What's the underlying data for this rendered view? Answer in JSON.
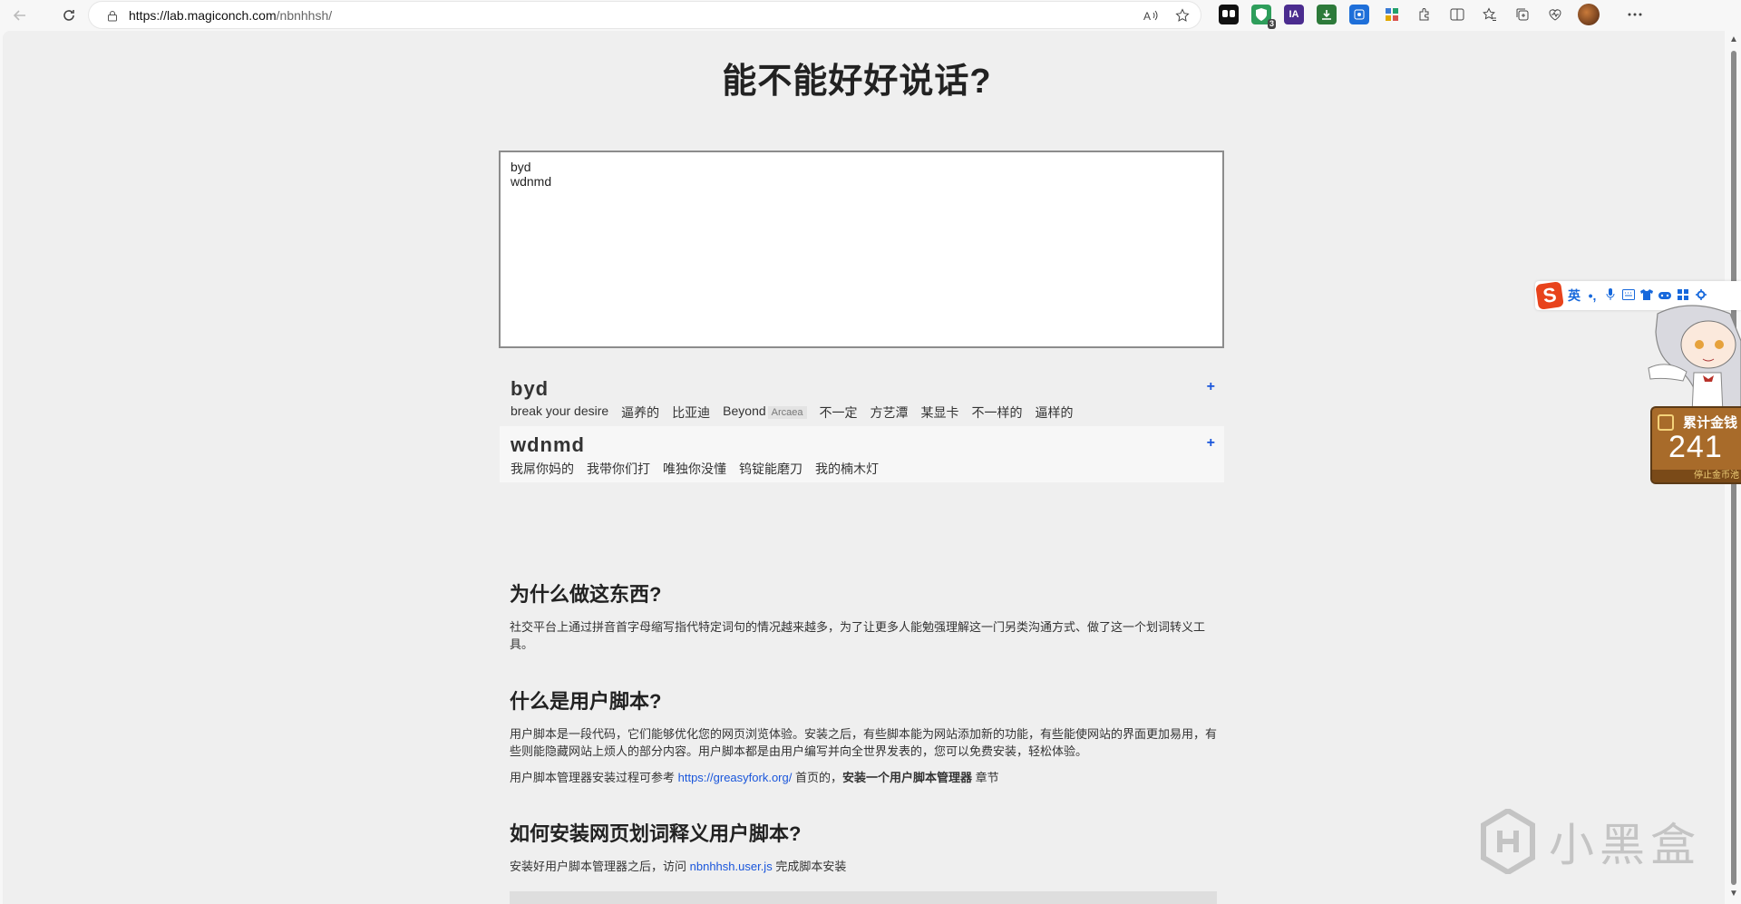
{
  "browser": {
    "url_host": "https://lab.magiconch.com",
    "url_path": "/nbnhhsh/",
    "extension_badge": "3",
    "extension_ia": "IA"
  },
  "page": {
    "title": "能不能好好说话?",
    "input_value": "byd\nwdnmd"
  },
  "results": [
    {
      "abbr": "byd",
      "translations": [
        "break your desire",
        "逼养的",
        "比亚迪",
        "Beyond",
        "不一定",
        "方艺潭",
        "某显卡",
        "不一样的",
        "逼样的"
      ],
      "beyond_tag": "Arcaea"
    },
    {
      "abbr": "wdnmd",
      "translations": [
        "我屌你妈的",
        "我带你们打",
        "唯独你没懂",
        "钨锭能磨刀",
        "我的楠木灯"
      ]
    }
  ],
  "article": {
    "h_why": "为什么做这东西?",
    "p_why": "社交平台上通过拼音首字母缩写指代特定词句的情况越来越多，为了让更多人能勉强理解这一门另类沟通方式、做了这一个划词转义工具。",
    "h_what": "什么是用户脚本?",
    "p_what": "用户脚本是一段代码，它们能够优化您的网页浏览体验。安装之后，有些脚本能为网站添加新的功能，有些能使网站的界面更加易用，有些则能隐藏网站上烦人的部分内容。用户脚本都是由用户编写并向全世界发表的，您可以免费安装，轻松体验。",
    "p_ref_prefix": "用户脚本管理器安装过程可参考 ",
    "p_ref_link": "https://greasyfork.org/",
    "p_ref_mid": " 首页的，",
    "p_ref_bold": "安装一个用户脚本管理器",
    "p_ref_suffix": " 章节",
    "h_how": "如何安装网页划词释义用户脚本?",
    "p_how_prefix": "安装好用户脚本管理器之后，访问 ",
    "p_how_link": "nbnhhsh.user.js",
    "p_how_suffix": " 完成脚本安装"
  },
  "ime": {
    "mode": "英",
    "punct": "•,",
    "plus": "+"
  },
  "coin_widget": {
    "label": "累计金钱",
    "value": "241",
    "stop_text": "停止金币池"
  },
  "watermark": {
    "text": "小黑盒"
  },
  "colors": {
    "link": "#1a56db",
    "page_bg": "#efefef",
    "ime_brand": "#e8431c"
  }
}
